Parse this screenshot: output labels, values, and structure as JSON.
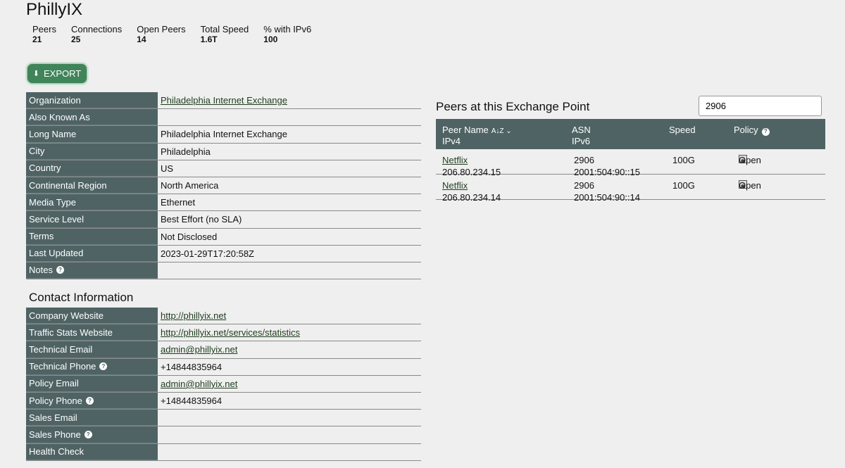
{
  "page": {
    "title": "PhillyIX"
  },
  "stats": [
    {
      "label": "Peers",
      "value": "21"
    },
    {
      "label": "Connections",
      "value": "25"
    },
    {
      "label": "Open Peers",
      "value": "14"
    },
    {
      "label": "Total Speed",
      "value": "1.6T"
    },
    {
      "label": "% with IPv6",
      "value": "100"
    }
  ],
  "export": {
    "label": "EXPORT",
    "icon": "download-icon",
    "color": "#40845a"
  },
  "info": [
    {
      "key": "Organization",
      "value": "Philadelphia Internet Exchange",
      "link": true
    },
    {
      "key": "Also Known As",
      "value": ""
    },
    {
      "key": "Long Name",
      "value": "Philadelphia Internet Exchange"
    },
    {
      "key": "City",
      "value": "Philadelphia"
    },
    {
      "key": "Country",
      "value": "US"
    },
    {
      "key": "Continental Region",
      "value": "North America"
    },
    {
      "key": "Media Type",
      "value": "Ethernet"
    },
    {
      "key": "Service Level",
      "value": "Best Effort (no SLA)"
    },
    {
      "key": "Terms",
      "value": "Not Disclosed"
    },
    {
      "key": "Last Updated",
      "value": "2023-01-29T17:20:58Z"
    },
    {
      "key": "Notes",
      "value": "",
      "help": true
    }
  ],
  "contact": {
    "heading": "Contact Information",
    "rows": [
      {
        "key": "Company Website",
        "value": "http://phillyix.net",
        "link": true
      },
      {
        "key": "Traffic Stats Website",
        "value": "http://phillyix.net/services/statistics",
        "link": true
      },
      {
        "key": "Technical Email",
        "value": "admin@phillyix.net",
        "link": true
      },
      {
        "key": "Technical Phone",
        "value": "+14844835964",
        "help": true
      },
      {
        "key": "Policy Email",
        "value": "admin@phillyix.net",
        "link": true
      },
      {
        "key": "Policy Phone",
        "value": "+14844835964",
        "help": true
      },
      {
        "key": "Sales Email",
        "value": ""
      },
      {
        "key": "Sales Phone",
        "value": "",
        "help": true
      },
      {
        "key": "Health Check",
        "value": ""
      }
    ]
  },
  "peers": {
    "heading": "Peers at this Exchange Point",
    "search_value": "2906",
    "columns": {
      "peer_name": "Peer Name",
      "ipv4": "IPv4",
      "asn": "ASN",
      "ipv6": "IPv6",
      "speed": "Speed",
      "policy": "Policy",
      "sort_icon": "A→Z sort-icon"
    },
    "rows": [
      {
        "name": "Netflix",
        "ipv4": "206.80.234.15",
        "asn": "2906",
        "ipv6": "2001:504:90::15",
        "speed": "100G",
        "policy": "Open"
      },
      {
        "name": "Netflix",
        "ipv4": "206.80.234.14",
        "asn": "2906",
        "ipv6": "2001:504:90::14",
        "speed": "100G",
        "policy": "Open"
      }
    ]
  }
}
